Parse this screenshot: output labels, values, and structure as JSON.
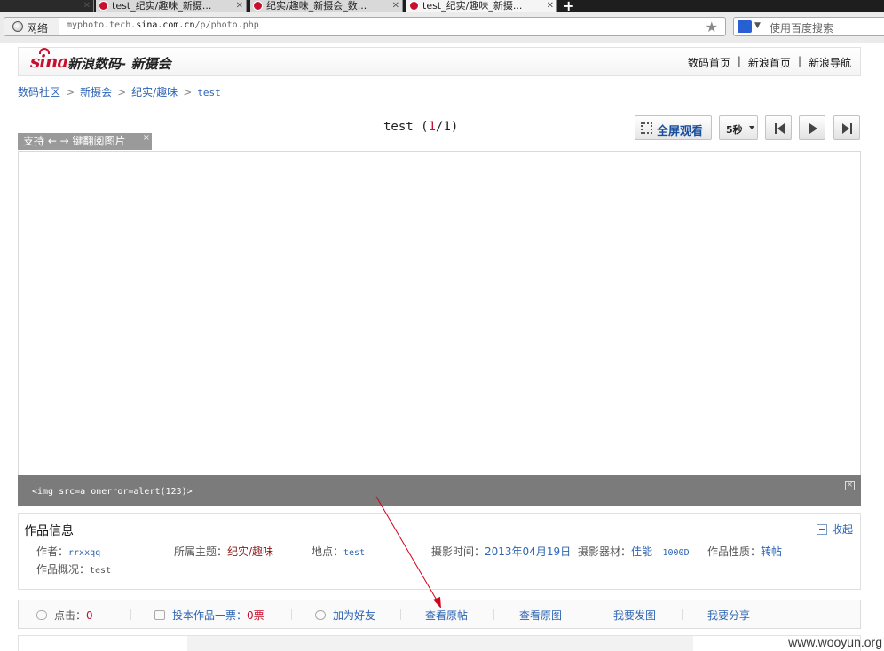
{
  "browser": {
    "tabs": [
      {
        "title": "test_纪实/趣味_新摄..."
      },
      {
        "title": "纪实/趣味_新摄会_数..."
      },
      {
        "title": "test_纪实/趣味_新摄..."
      }
    ],
    "site_label": "网络",
    "url_prefix": "myphoto.tech.",
    "url_domain": "sina.com.cn",
    "url_path": "/p/photo.php",
    "search_placeholder": "使用百度搜索"
  },
  "header": {
    "logo_text": "sina",
    "site_title": "新浪数码- 新摄会",
    "nav": [
      "数码首页",
      "新浪首页",
      "新浪导航"
    ],
    "nav_sep": "|"
  },
  "breadcrumb": {
    "items": [
      "数码社区",
      "新摄会",
      "纪实/趣味",
      "test"
    ],
    "sep": ">"
  },
  "viewer": {
    "title": "test",
    "counter_open": "(",
    "current": "1",
    "counter_rest": "/1)",
    "fullscreen_label": "全屏观看",
    "interval_label": "5秒",
    "hint": "支持 ← → 键翻阅图片",
    "hint_close": "×",
    "caption": "<img src=a onerror=alert(123)>",
    "caption_close": "×"
  },
  "info": {
    "heading": "作品信息",
    "collapse_label": "收起",
    "fields": {
      "author_label": "作者：",
      "author": "rrxxqq",
      "topic_label": "所属主题：",
      "topic": "纪实/趣味",
      "place_label": "地点：",
      "place": "test",
      "time_label": "摄影时间：",
      "time": "2013年04月19日",
      "gear_label": "摄影器材：",
      "gear_brand": "佳能",
      "gear_model": "1000D",
      "nature_label": "作品性质：",
      "nature": "转帖",
      "summary_label": "作品概况：",
      "summary": "test"
    }
  },
  "actions": {
    "clicks_label": "点击：",
    "clicks": "0",
    "vote_label": "投本作品一票：",
    "votes": "0",
    "votes_unit": "票",
    "add_friend": "加为好友",
    "view_post": "查看原帖",
    "view_original": "查看原图",
    "post_photo": "我要发图",
    "share": "我要分享"
  },
  "watermark": "www.wooyun.org",
  "colors": {
    "sina_red": "#c8102e",
    "link_blue": "#2d64b3",
    "caption_bg": "#7b7b7b",
    "annotation_arrow": "#d0021b"
  }
}
